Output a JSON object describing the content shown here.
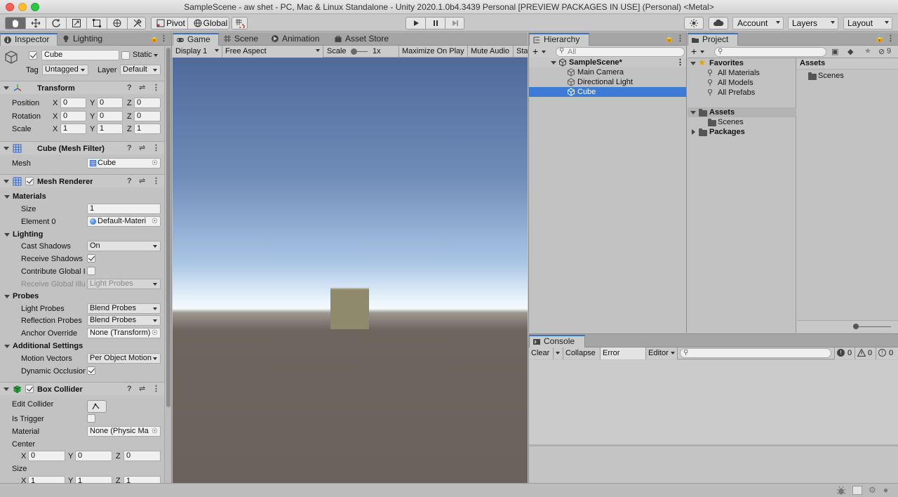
{
  "window": {
    "title": "SampleScene - aw shet - PC, Mac & Linux Standalone - Unity 2020.1.0b4.3439 Personal [PREVIEW PACKAGES IN USE] (Personal) <Metal>"
  },
  "toolbar": {
    "pivot": "Pivot",
    "global": "Global",
    "account": "Account",
    "layers": "Layers",
    "layout": "Layout"
  },
  "inspector": {
    "tabs": [
      "Inspector",
      "Lighting"
    ],
    "object_name": "Cube",
    "static_label": "Static",
    "tag_label": "Tag",
    "tag_value": "Untagged",
    "layer_label": "Layer",
    "layer_value": "Default",
    "transform": {
      "title": "Transform",
      "rows": [
        {
          "label": "Position",
          "x": "0",
          "y": "0",
          "z": "0"
        },
        {
          "label": "Rotation",
          "x": "0",
          "y": "0",
          "z": "0"
        },
        {
          "label": "Scale",
          "x": "1",
          "y": "1",
          "z": "1"
        }
      ]
    },
    "mesh_filter": {
      "title": "Cube (Mesh Filter)",
      "mesh_label": "Mesh",
      "mesh_value": "Cube"
    },
    "mesh_renderer": {
      "title": "Mesh Renderer",
      "materials": "Materials",
      "size_label": "Size",
      "size_value": "1",
      "element0_label": "Element 0",
      "element0_value": "Default-Materi",
      "lighting": "Lighting",
      "cast_shadows_label": "Cast Shadows",
      "cast_shadows_value": "On",
      "receive_shadows_label": "Receive Shadows",
      "contribute_gi_label": "Contribute Global I",
      "receive_gi_label": "Receive Global Illu",
      "receive_gi_value": "Light Probes",
      "probes": "Probes",
      "light_probes_label": "Light Probes",
      "light_probes_value": "Blend Probes",
      "reflection_probes_label": "Reflection Probes",
      "reflection_probes_value": "Blend Probes",
      "anchor_label": "Anchor Override",
      "anchor_value": "None (Transform)",
      "additional": "Additional Settings",
      "motion_label": "Motion Vectors",
      "motion_value": "Per Object Motion",
      "dynamic_label": "Dynamic Occlusion"
    },
    "box_collider": {
      "title": "Box Collider",
      "edit_label": "Edit Collider",
      "trigger_label": "Is Trigger",
      "material_label": "Material",
      "material_value": "None (Physic Ma",
      "center_label": "Center",
      "center": {
        "x": "0",
        "y": "0",
        "z": "0"
      },
      "size_label": "Size",
      "size": {
        "x": "1",
        "y": "1",
        "z": "1"
      }
    }
  },
  "game": {
    "tabs": [
      "Game",
      "Scene",
      "Animation",
      "Asset Store"
    ],
    "display": "Display 1",
    "aspect": "Free Aspect",
    "scale_label": "Scale",
    "scale_value": "1x",
    "maximize": "Maximize On Play",
    "mute": "Mute Audio",
    "stats": "Sta"
  },
  "hierarchy": {
    "tab": "Hierarchy",
    "search_placeholder": "All",
    "scene": "SampleScene*",
    "items": [
      "Main Camera",
      "Directional Light",
      "Cube"
    ]
  },
  "project": {
    "tab": "Project",
    "hidden_count": "9",
    "favorites": "Favorites",
    "fav_items": [
      "All Materials",
      "All Models",
      "All Prefabs"
    ],
    "assets": "Assets",
    "asset_children": [
      "Scenes"
    ],
    "packages": "Packages",
    "right_header": "Assets",
    "right_items": [
      "Scenes"
    ]
  },
  "console": {
    "tab": "Console",
    "clear": "Clear",
    "collapse": "Collapse",
    "error_pause": "Error Pause",
    "editor": "Editor",
    "info_count": "0",
    "warn_count": "0",
    "error_count": "0"
  },
  "colors": {
    "accent": "#3a72c4",
    "selection": "#3e7bd6",
    "sky_top": "#4f6a9b",
    "ground": "#6c625d",
    "cube": "#8f8a6b"
  }
}
